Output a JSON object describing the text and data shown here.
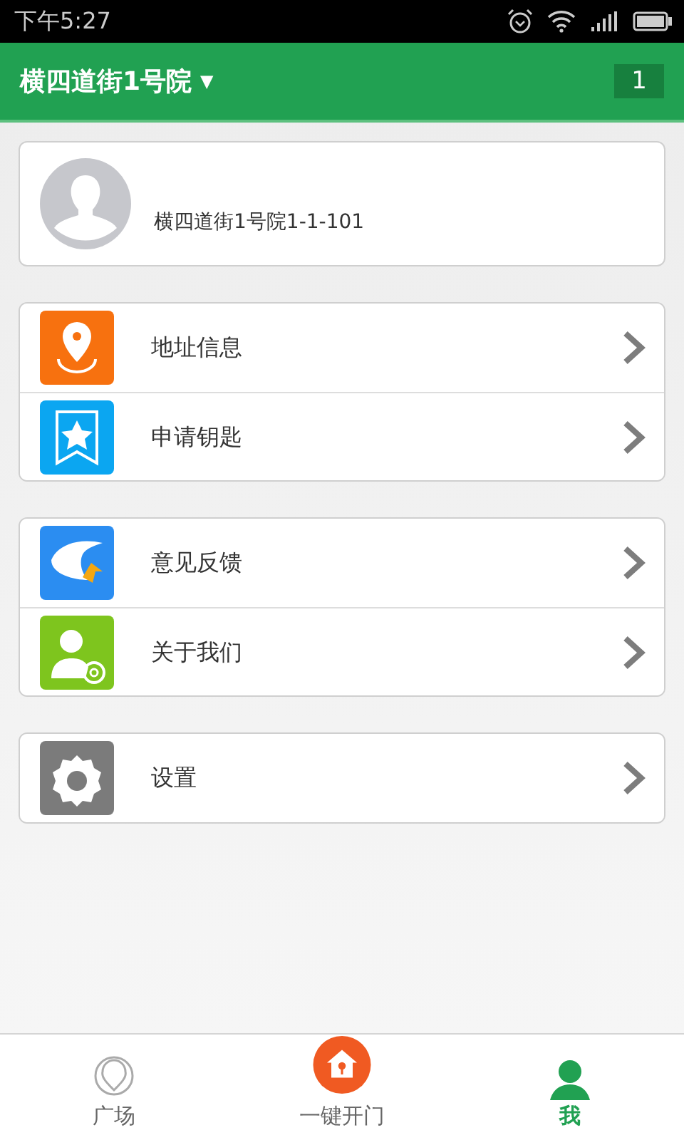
{
  "status_bar": {
    "time": "下午5:27"
  },
  "header": {
    "title": "横四道街1号院",
    "caret": "▼",
    "badge": "1"
  },
  "profile": {
    "address": "横四道街1号院1-1-101"
  },
  "menu_groups": [
    {
      "items": [
        {
          "label": "地址信息",
          "kind": "location"
        },
        {
          "label": "申请钥匙",
          "kind": "key"
        }
      ]
    },
    {
      "items": [
        {
          "label": "意见反馈",
          "kind": "feedback"
        },
        {
          "label": "关于我们",
          "kind": "about"
        }
      ]
    },
    {
      "items": [
        {
          "label": "设置",
          "kind": "settings"
        }
      ]
    }
  ],
  "bottom_nav": [
    {
      "label": "广场",
      "kind": "plaza",
      "selected": false
    },
    {
      "label": "一键开门",
      "kind": "open",
      "selected": false
    },
    {
      "label": "我",
      "kind": "me",
      "selected": true
    }
  ]
}
